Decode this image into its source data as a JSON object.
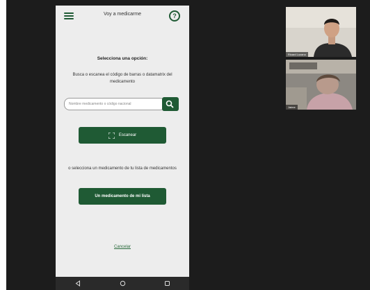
{
  "app": {
    "title": "Voy a medicarme",
    "help_symbol": "?"
  },
  "main": {
    "section_title": "Selecciona una opción:",
    "description": "Busca o escanea el código de barras o datamatrix del medicamento",
    "search_placeholder": "Nombre medicamento o código nacional",
    "scan_label": "Escanear",
    "or_text": "o selecciona un medicamento de tu lista de medicamentos",
    "my_list_label": "Un medicamento de mi lista",
    "cancel_label": "Cancelar"
  },
  "video": {
    "participant1_name": "Ricard Lozano",
    "participant2_name": "Jaime"
  },
  "icons": {
    "menu": "menu-icon",
    "help": "help-icon",
    "search": "search-icon",
    "scan": "scan-icon",
    "nav_back": "back-icon",
    "nav_home": "home-icon",
    "nav_recents": "recents-icon"
  },
  "colors": {
    "accent": "#1f5a34",
    "background": "#1c1c1c",
    "phone_bg": "#ededed"
  }
}
